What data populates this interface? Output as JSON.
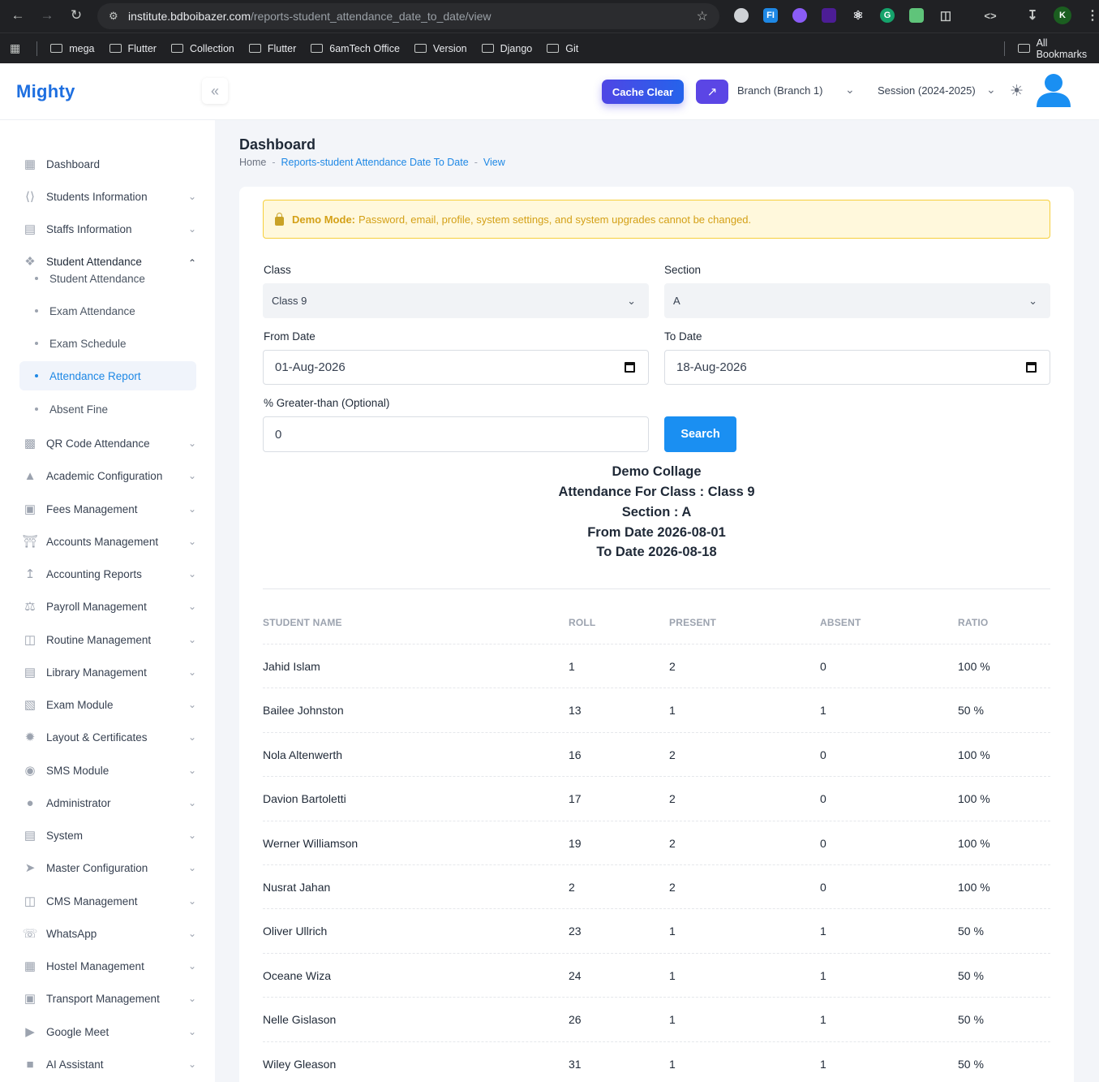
{
  "browser": {
    "url_host": "institute.bdboibazer.com",
    "url_path": "/reports-student_attendance_date_to_date/view",
    "avatar_letter": "K",
    "bookmarks": [
      "mega",
      "Flutter",
      "Collection",
      "Flutter",
      "6amTech Office",
      "Version",
      "Django",
      "Git"
    ],
    "all_bookmarks": "All Bookmarks"
  },
  "header": {
    "logo": "Mighty",
    "cache_clear": "Cache Clear",
    "branch": "Branch (Branch 1)",
    "session": "Session (2024-2025)"
  },
  "sidebar": {
    "items": [
      {
        "label": "Dashboard",
        "icon": "dashboard-icon"
      },
      {
        "label": "Students Information",
        "icon": "code-icon"
      },
      {
        "label": "Staffs Information",
        "icon": "staff-icon"
      },
      {
        "label": "Student Attendance",
        "icon": "attendance-icon"
      },
      {
        "label": "QR Code Attendance",
        "icon": "qr-code-icon"
      },
      {
        "label": "Academic Configuration",
        "icon": "academic-icon"
      },
      {
        "label": "Fees Management",
        "icon": "fees-icon"
      },
      {
        "label": "Accounts Management",
        "icon": "bank-icon"
      },
      {
        "label": "Accounting Reports",
        "icon": "chart-icon"
      },
      {
        "label": "Payroll Management",
        "icon": "payroll-icon"
      },
      {
        "label": "Routine Management",
        "icon": "map-icon"
      },
      {
        "label": "Library Management",
        "icon": "library-icon"
      },
      {
        "label": "Exam Module",
        "icon": "exam-icon"
      },
      {
        "label": "Layout & Certificates",
        "icon": "badge-icon"
      },
      {
        "label": "SMS Module",
        "icon": "sms-icon"
      },
      {
        "label": "Administrator",
        "icon": "user-shield-icon"
      },
      {
        "label": "System",
        "icon": "server-icon"
      },
      {
        "label": "Master Configuration",
        "icon": "rocket-icon"
      },
      {
        "label": "CMS Management",
        "icon": "map-icon"
      },
      {
        "label": "WhatsApp",
        "icon": "whatsapp-icon"
      },
      {
        "label": "Hostel Management",
        "icon": "building-icon"
      },
      {
        "label": "Transport Management",
        "icon": "bus-icon"
      },
      {
        "label": "Google Meet",
        "icon": "video-icon"
      },
      {
        "label": "AI Assistant",
        "icon": "robot-icon"
      }
    ],
    "sub_items": [
      "Student Attendance",
      "Exam Attendance",
      "Exam Schedule",
      "Attendance Report",
      "Absent Fine"
    ]
  },
  "page": {
    "title": "Dashboard",
    "breadcrumb": [
      "Home",
      "Reports-student Attendance Date To Date",
      "View"
    ]
  },
  "demo": {
    "strong": "Demo Mode:",
    "text": "Password, email, profile, system settings, and system upgrades cannot be changed."
  },
  "form": {
    "class_label": "Class",
    "class_value": "Class 9",
    "section_label": "Section",
    "section_value": "A",
    "from_label": "From Date",
    "from_value": "01-Aug-2026",
    "to_label": "To Date",
    "to_value": "18-Aug-2026",
    "pct_label": "% Greater-than (Optional)",
    "pct_value": "0",
    "search": "Search"
  },
  "report": {
    "lines": [
      "Demo Collage",
      "Attendance For Class : Class 9",
      "Section : A",
      "From Date 2026-08-01",
      "To Date 2026-08-18"
    ]
  },
  "table": {
    "headers": [
      "STUDENT NAME",
      "ROLL",
      "PRESENT",
      "ABSENT",
      "RATIO"
    ],
    "rows": [
      [
        "Jahid Islam",
        "1",
        "2",
        "0",
        "100 %"
      ],
      [
        "Bailee Johnston",
        "13",
        "1",
        "1",
        "50 %"
      ],
      [
        "Nola Altenwerth",
        "16",
        "2",
        "0",
        "100 %"
      ],
      [
        "Davion Bartoletti",
        "17",
        "2",
        "0",
        "100 %"
      ],
      [
        "Werner Williamson",
        "19",
        "2",
        "0",
        "100 %"
      ],
      [
        "Nusrat Jahan",
        "2",
        "2",
        "0",
        "100 %"
      ],
      [
        "Oliver Ullrich",
        "23",
        "1",
        "1",
        "50 %"
      ],
      [
        "Oceane Wiza",
        "24",
        "1",
        "1",
        "50 %"
      ],
      [
        "Nelle Gislason",
        "26",
        "1",
        "1",
        "50 %"
      ],
      [
        "Wiley Gleason",
        "31",
        "1",
        "1",
        "50 %"
      ]
    ]
  },
  "colors": {
    "accent": "#1e88e5",
    "primary_button": "#1a8ff2",
    "cache_button": "#4f46e5",
    "warning": "#d4a017"
  }
}
